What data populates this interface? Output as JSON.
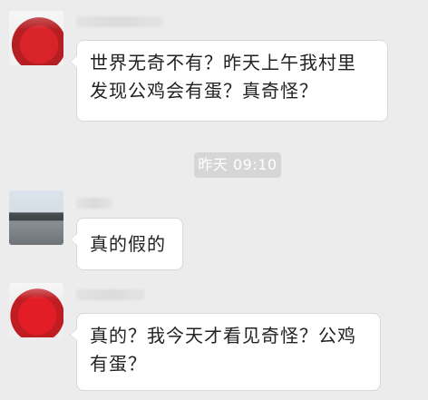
{
  "messages": [
    {
      "text": "世界无奇不有？昨天上午我村里发现公鸡会有蛋？真奇怪？"
    },
    {
      "text": "真的假的"
    },
    {
      "text": "真的？我今天才看见奇怪？公鸡有蛋？"
    }
  ],
  "timestamp": "昨天 09:10",
  "colors": {
    "background": "#ececec",
    "bubble": "#ffffff",
    "bubble_border": "#d8d8d8",
    "timestamp_bg": "#d6d6d6",
    "text": "#222222"
  }
}
